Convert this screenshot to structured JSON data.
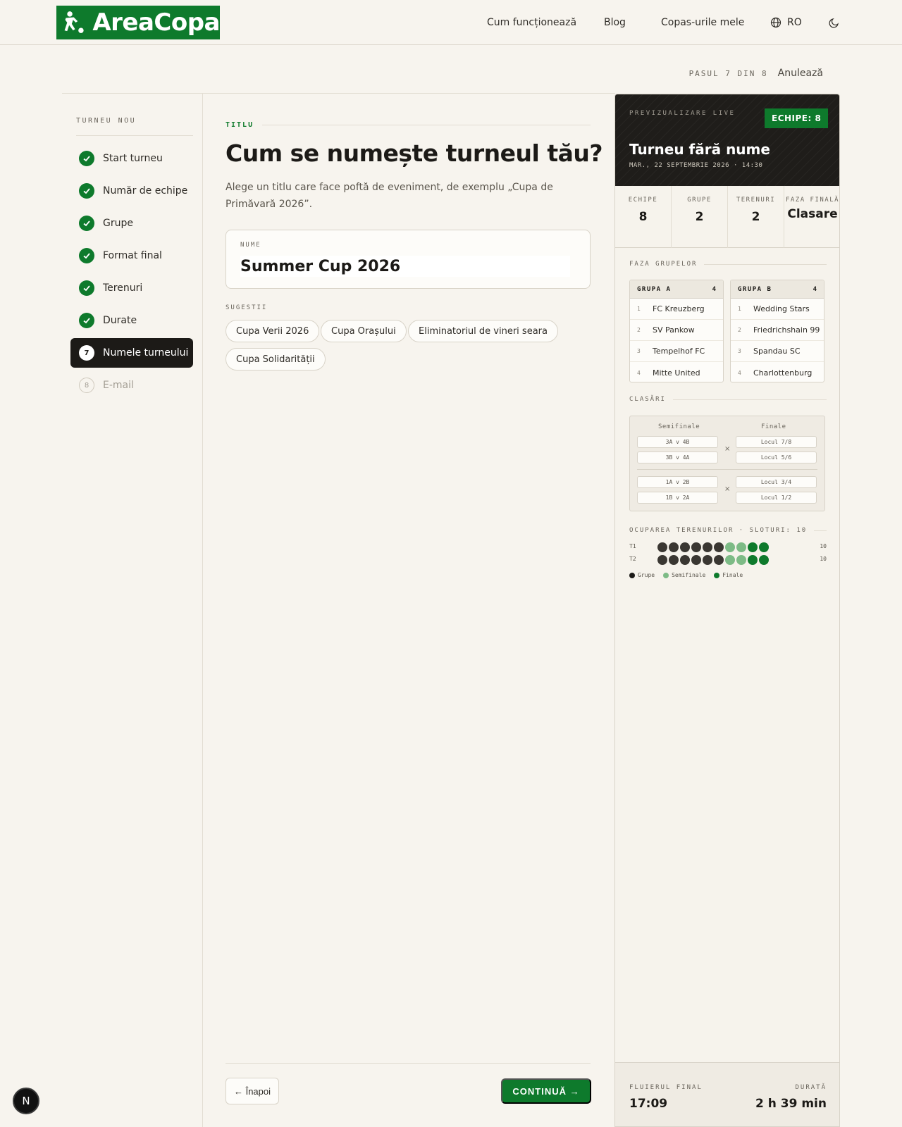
{
  "brand": {
    "name": "AreaCopa",
    "color": "#0e7a2c"
  },
  "nav": {
    "items": [
      "Cum funcționează",
      "Blog",
      "Copas-urile mele"
    ],
    "lang": "RO"
  },
  "progress": {
    "label": "PASUL 7 DIN 8",
    "cancel": "Anulează"
  },
  "sidebar": {
    "title": "TURNEU NOU",
    "items": [
      {
        "label": "Start turneu",
        "state": "done"
      },
      {
        "label": "Număr de echipe",
        "state": "done"
      },
      {
        "label": "Grupe",
        "state": "done"
      },
      {
        "label": "Format final",
        "state": "done"
      },
      {
        "label": "Terenuri",
        "state": "done"
      },
      {
        "label": "Durate",
        "state": "done"
      },
      {
        "label": "Numele turneului",
        "state": "active",
        "num": "7"
      },
      {
        "label": "E-mail",
        "state": "pending",
        "num": "8"
      }
    ]
  },
  "form": {
    "eyebrow": "TITLU",
    "heading": "Cum se numește turneul tău?",
    "description": "Alege un titlu care face poftă de eveniment, de exemplu „Cupa de Primăvară 2026”.",
    "input_label": "NUME",
    "input_value": "Summer Cup 2026",
    "suggestions_label": "SUGESTII",
    "suggestions": [
      "Cupa Verii 2026",
      "Cupa Orașului",
      "Eliminatoriul de vineri seara",
      "Cupa Solidarității"
    ],
    "back": "← Înapoi",
    "next": "CONTINUĂ →"
  },
  "preview": {
    "live_label": "PREVIZUALIZARE LIVE",
    "badge": "ECHIPE: 8",
    "title": "Turneu fără nume",
    "date": "MAR., 22 SEPTEMBRIE 2026 · 14:30",
    "stats": [
      {
        "label": "ECHIPE",
        "value": "8"
      },
      {
        "label": "GRUPE",
        "value": "2"
      },
      {
        "label": "TERENURI",
        "value": "2"
      },
      {
        "label": "FAZA FINALĂ",
        "value": "Clasare"
      }
    ],
    "groups_title": "FAZA GRUPELOR",
    "groups": [
      {
        "name": "GRUPA A",
        "count": "4",
        "teams": [
          {
            "n": "1",
            "name": "FC Kreuzberg"
          },
          {
            "n": "2",
            "name": "SV Pankow"
          },
          {
            "n": "3",
            "name": "Tempelhof FC"
          },
          {
            "n": "4",
            "name": "Mitte United"
          }
        ]
      },
      {
        "name": "GRUPA B",
        "count": "4",
        "teams": [
          {
            "n": "1",
            "name": "Wedding Stars"
          },
          {
            "n": "2",
            "name": "Friedrichshain 99"
          },
          {
            "n": "3",
            "name": "Spandau SC"
          },
          {
            "n": "4",
            "name": "Charlottenburg"
          }
        ]
      }
    ],
    "rankings_title": "CLASĂRI",
    "bracket": {
      "semis_label": "Semifinale",
      "finals_label": "Finale",
      "semis": [
        "3A v 4B",
        "3B v 4A",
        "1A v 2B",
        "1B v 2A"
      ],
      "finals": [
        "Locul 7/8",
        "Locul 5/6",
        "Locul 3/4",
        "Locul 1/2"
      ],
      "x": "×"
    },
    "courts_title": "OCUPAREA TERENURILOR · SLOTURI: 10",
    "courts": [
      {
        "label": "T1",
        "total": "10",
        "slots": [
          "g",
          "g",
          "g",
          "g",
          "g",
          "g",
          "s",
          "s",
          "f",
          "f"
        ]
      },
      {
        "label": "T2",
        "total": "10",
        "slots": [
          "g",
          "g",
          "g",
          "g",
          "g",
          "g",
          "s",
          "s",
          "f",
          "f"
        ]
      }
    ],
    "slot_colors": {
      "g": "#3a3732",
      "s": "#7dbb86",
      "f": "#0e7a2c"
    },
    "legend": [
      "Grupe",
      "Semifinale",
      "Finale"
    ],
    "footer": {
      "left_label": "FLUIERUL FINAL",
      "left_value": "17:09",
      "right_label": "DURATĂ",
      "right_value": "2 h 39 min"
    }
  },
  "fab": {
    "label": "N"
  }
}
